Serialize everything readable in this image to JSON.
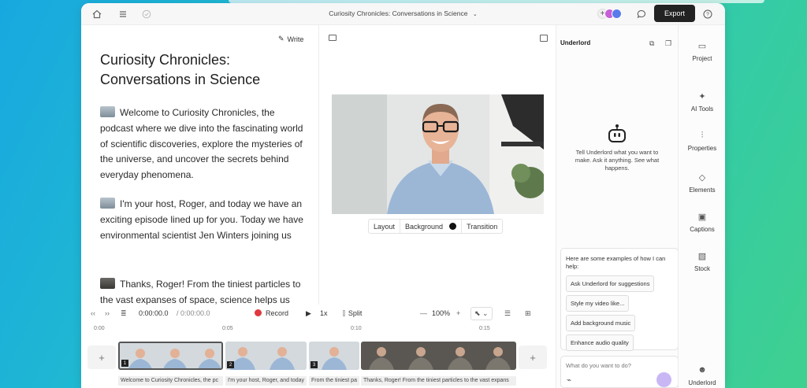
{
  "header": {
    "title": "Curiosity Chronicles: Conversations in Science",
    "export_label": "Export",
    "icons": [
      "home-icon",
      "menu-icon",
      "check-circle-icon",
      "chevron-down-icon",
      "add-collaborator-icon",
      "comment-icon",
      "help-icon"
    ]
  },
  "script": {
    "write_label": "Write",
    "title": "Curiosity Chronicles: Conversations in Science",
    "paragraphs": [
      "Welcome to Curiosity Chronicles, the podcast where we dive into the fascinating world of scientific discoveries, explore the mysteries of the universe, and uncover the secrets behind everyday phenomena.",
      "I'm your host, Roger, and today we have an exciting episode lined up for you. Today we have environmental scientist Jen Winters joining us",
      "Thanks, Roger! From the tiniest particles to the vast expanses of space, science helps us"
    ]
  },
  "preview": {
    "controls": {
      "layout": "Layout",
      "background": "Background",
      "transition": "Transition"
    }
  },
  "underlord": {
    "title": "Underlord",
    "message": "Tell Underlord what you want to make. Ask it anything. See what happens.",
    "examples_intro": "Here are some examples of how I can help:",
    "suggestions": [
      "Ask Underlord for suggestions",
      "Style my video like...",
      "Add background music",
      "Enhance audio quality"
    ],
    "input_placeholder": "What do you want to do?"
  },
  "rail": {
    "items": [
      {
        "label": "Project",
        "icon": "folder-icon"
      },
      {
        "label": "AI Tools",
        "icon": "sparkle-icon"
      },
      {
        "label": "Properties",
        "icon": "sliders-icon"
      },
      {
        "label": "Elements",
        "icon": "shapes-icon"
      },
      {
        "label": "Captions",
        "icon": "captions-icon"
      },
      {
        "label": "Stock",
        "icon": "stock-media-icon"
      },
      {
        "label": "Underlord",
        "icon": "robot-icon"
      }
    ]
  },
  "timeline": {
    "timecode": "0:00:00.0",
    "duration": "/ 0:00:00.0",
    "record_label": "Record",
    "speed": "1x",
    "split_label": "Split",
    "zoom": "100%",
    "ruler": [
      "0:00",
      "0:05",
      "0:10",
      "0:15"
    ],
    "clips": [
      {
        "num": "1",
        "caption": "Welcome to Curiosity Chronicles, the pc"
      },
      {
        "num": "2",
        "caption": "I'm your host, Roger, and today"
      },
      {
        "num": "3",
        "caption": "From the tiniest pa"
      },
      {
        "num": "",
        "caption": "Thanks, Roger! From the tiniest particles to the vast expans"
      }
    ]
  },
  "colors": {
    "record": "#e0383e",
    "export_bg": "#222222",
    "send": "#c9b7f5"
  }
}
